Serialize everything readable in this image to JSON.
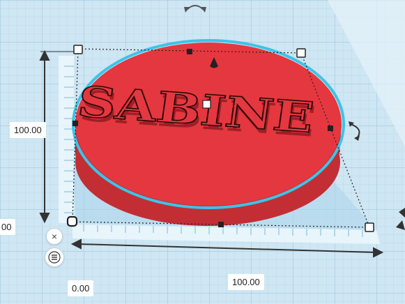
{
  "workplane": {
    "label": "SABINE",
    "shape_color": "#e5373f",
    "selection_outline_color": "#3cc4e8"
  },
  "dimensions": {
    "height_value": "100.00",
    "width_value": "100.00",
    "origin_x_value": "0.00",
    "left_offset_value": "00"
  },
  "icons": {
    "rotate_top": "rotate-arrows-icon",
    "rotate_right": "rotate-arrows-icon",
    "lift": "cone-lift-icon",
    "close": "close-icon",
    "menu": "list-menu-icon"
  }
}
